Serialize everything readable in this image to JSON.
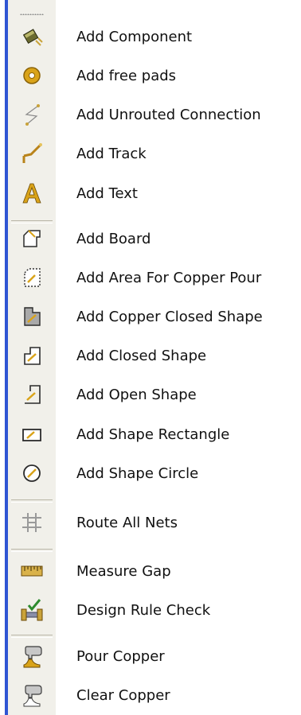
{
  "toolbar": {
    "items": [
      {
        "label": "Add Component",
        "icon": "component-icon"
      },
      {
        "label": "Add free pads",
        "icon": "pad-icon"
      },
      {
        "label": "Add Unrouted Connection",
        "icon": "unrouted-connection-icon"
      },
      {
        "label": "Add Track",
        "icon": "track-icon"
      },
      {
        "label": "Add Text",
        "icon": "text-icon"
      },
      {
        "label": "Add Board",
        "icon": "board-icon"
      },
      {
        "label": "Add Area For Copper Pour",
        "icon": "copper-pour-area-icon"
      },
      {
        "label": "Add Copper Closed Shape",
        "icon": "copper-closed-shape-icon"
      },
      {
        "label": "Add Closed Shape",
        "icon": "closed-shape-icon"
      },
      {
        "label": "Add Open Shape",
        "icon": "open-shape-icon"
      },
      {
        "label": "Add Shape Rectangle",
        "icon": "shape-rectangle-icon"
      },
      {
        "label": "Add Shape Circle",
        "icon": "shape-circle-icon"
      },
      {
        "label": "Route All Nets",
        "icon": "route-all-nets-icon"
      },
      {
        "label": "Measure Gap",
        "icon": "measure-gap-icon"
      },
      {
        "label": "Design Rule Check",
        "icon": "design-rule-check-icon"
      },
      {
        "label": "Pour Copper",
        "icon": "pour-copper-icon"
      },
      {
        "label": "Clear Copper",
        "icon": "clear-copper-icon"
      }
    ]
  },
  "colors": {
    "toolbar_background": "#f1f0ea",
    "accent_edge": "#2f55d3"
  }
}
